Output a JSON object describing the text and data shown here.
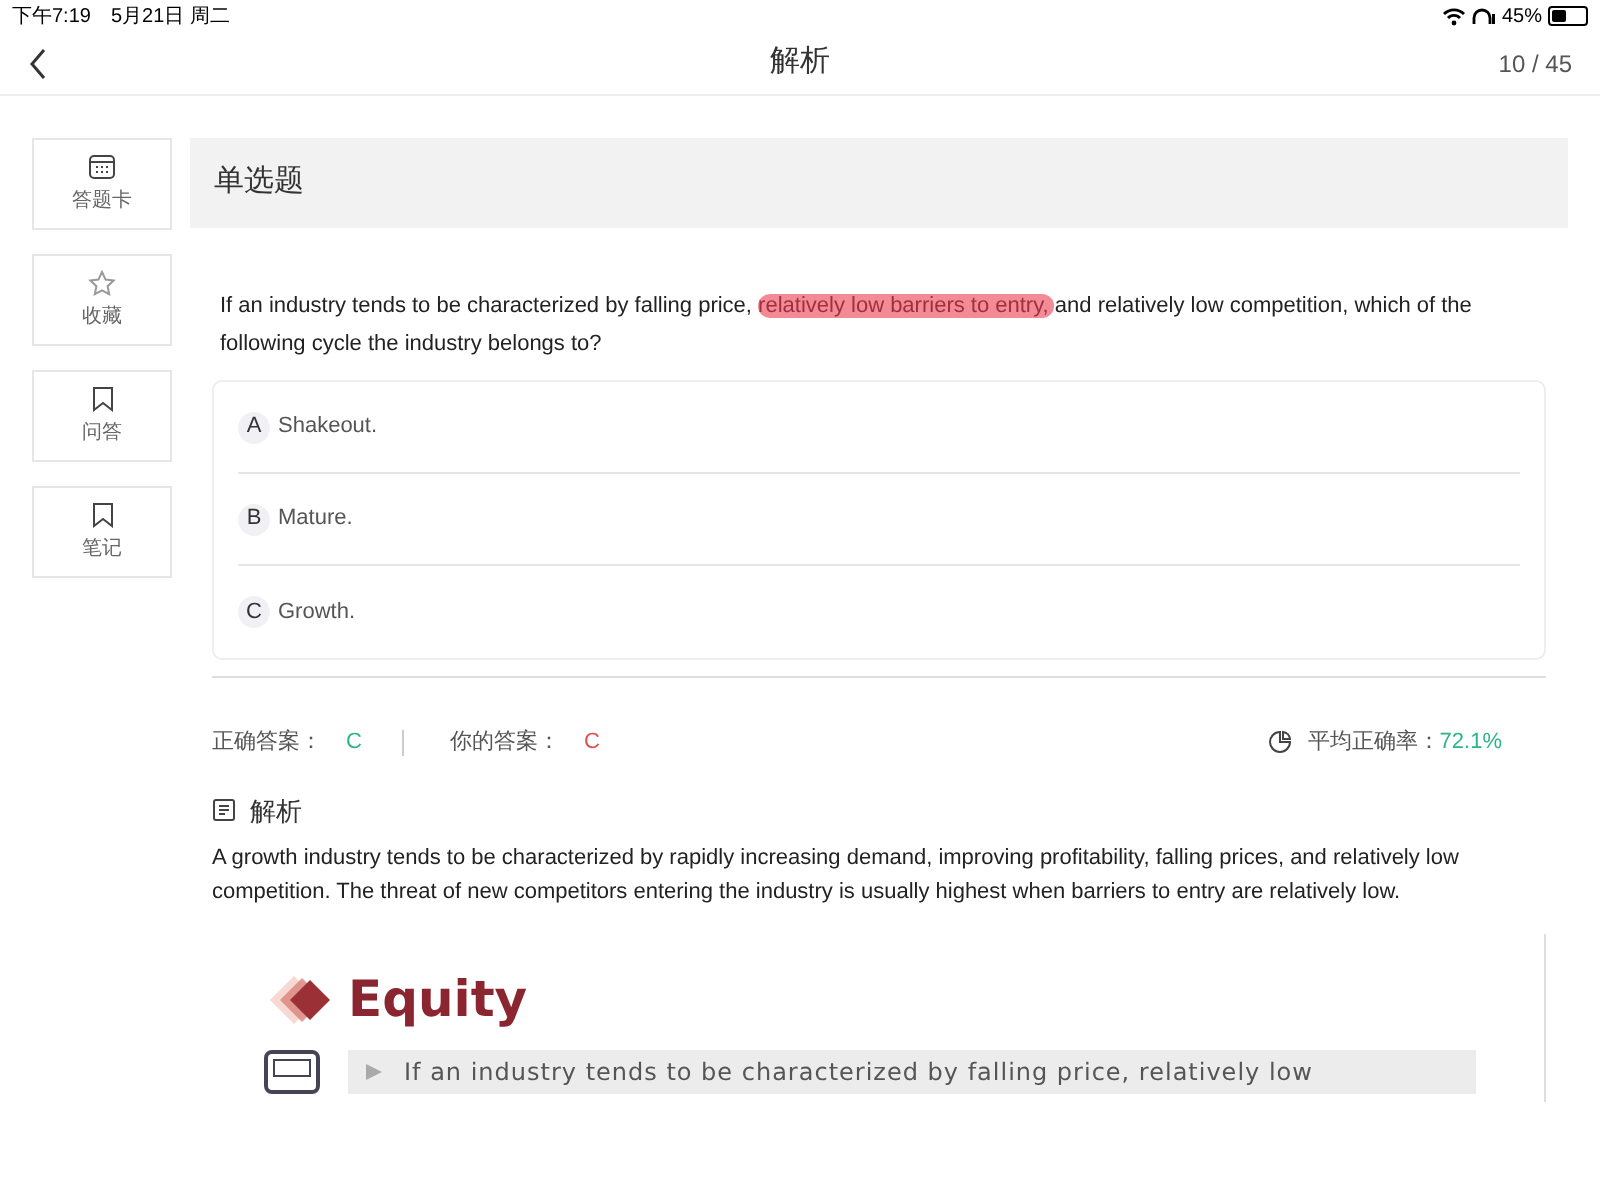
{
  "status_bar": {
    "time": "下午7:19",
    "date": "5月21日 周二",
    "battery_percent": "45%"
  },
  "nav": {
    "title": "解析",
    "counter": "10 / 45"
  },
  "side_buttons": [
    {
      "label": "答题卡",
      "kind": "card"
    },
    {
      "label": "收藏",
      "kind": "star"
    },
    {
      "label": "问答",
      "kind": "bookmark"
    },
    {
      "label": "笔记",
      "kind": "bookmark"
    }
  ],
  "question": {
    "type_title": "单选题",
    "text_segments": [
      {
        "text": "If an industry tends to be characterized by falling price, ",
        "highlighted": false
      },
      {
        "text": "relatively low barriers to entry, ",
        "highlighted": true
      },
      {
        "text": "and relatively low competition, which of the following cycle the industry belongs to?",
        "highlighted": false
      }
    ],
    "options": [
      {
        "letter": "A",
        "text": "Shakeout."
      },
      {
        "letter": "B",
        "text": "Mature."
      },
      {
        "letter": "C",
        "text": "Growth."
      }
    ]
  },
  "answers": {
    "correct_label": "正确答案：",
    "correct": "C",
    "yours_label": "你的答案：",
    "yours": "C",
    "average_label": "平均正确率：",
    "average": "72.1%"
  },
  "analysis": {
    "title": "解析",
    "text": "A growth industry tends to be characterized by rapidly increasing demand, improving profitability, falling prices, and relatively low competition. The threat of new competitors entering the industry is usually highest when barriers to entry are relatively low.",
    "image": {
      "heading": "Equity",
      "quote": "If an industry tends to be characterized by falling price, relatively low"
    }
  }
}
